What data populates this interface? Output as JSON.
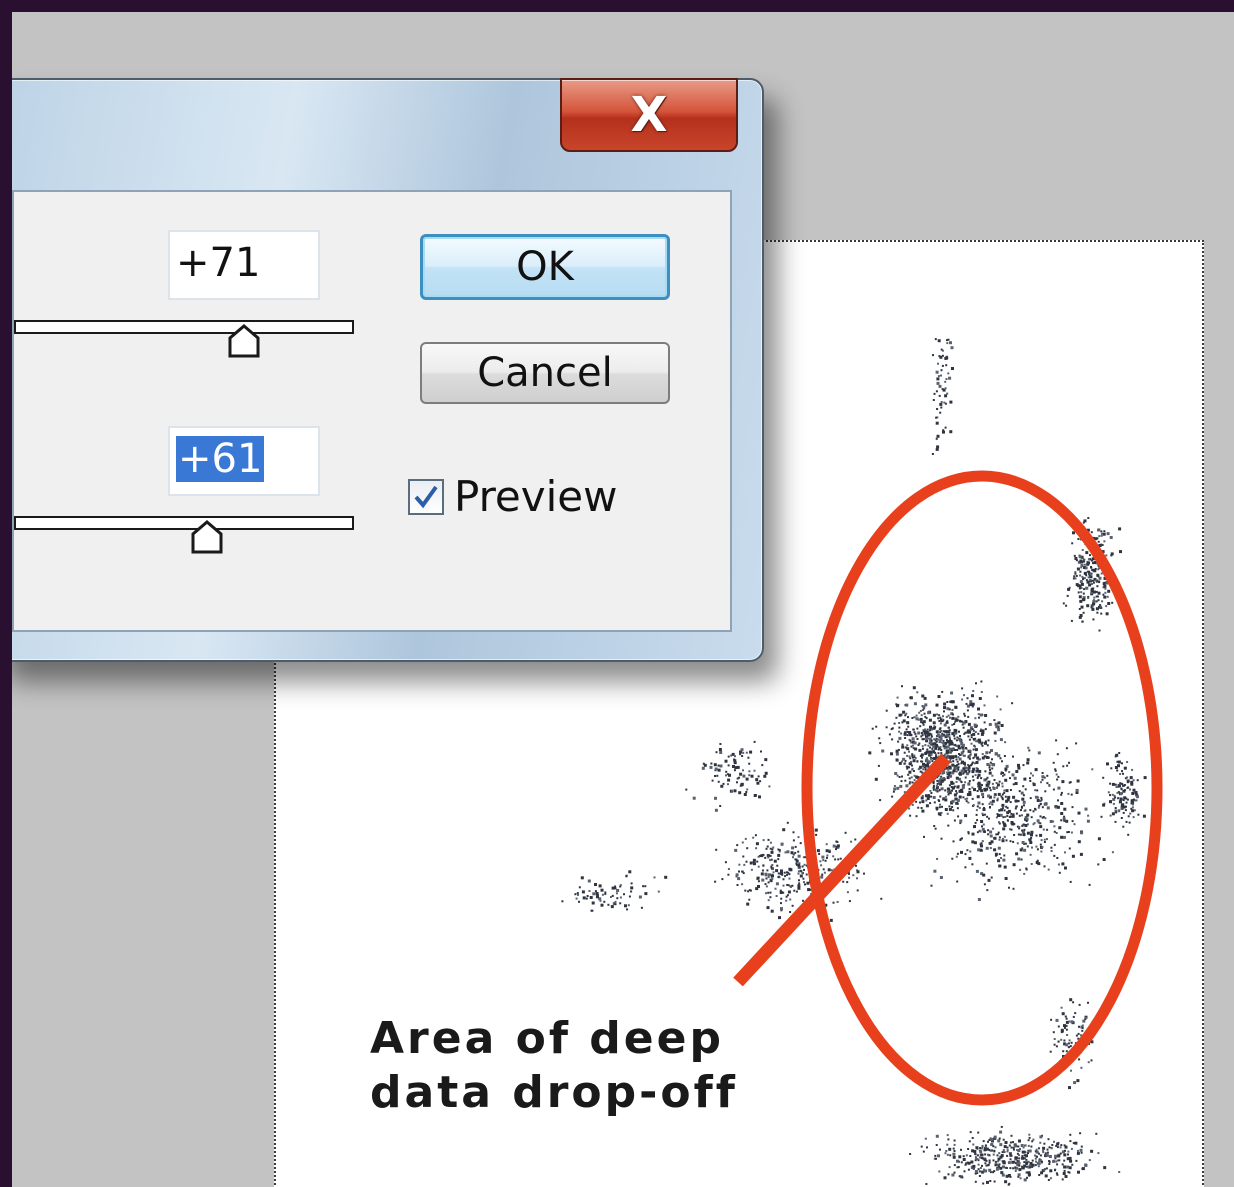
{
  "dialog": {
    "close_glyph": "X",
    "field_1_value": "+71",
    "slider_1_level_percent": 68,
    "field_2_value": "+61",
    "slider_2_level_percent": 57,
    "ok_label": "OK",
    "cancel_label": "Cancel",
    "preview_label": "Preview",
    "preview_checked": true
  },
  "annotation": {
    "text": "Area of deep\ndata drop-off",
    "color": "#e8401c"
  },
  "colors": {
    "background": "#2a1030",
    "workspace": "#c3c3c3",
    "close_button": "#c8452b",
    "ok_border": "#3e8fc0",
    "selection": "#3a78d6"
  },
  "icons": {
    "close": "close-icon",
    "checkmark": "checkmark-icon",
    "slider_thumb": "slider-thumb-icon"
  }
}
